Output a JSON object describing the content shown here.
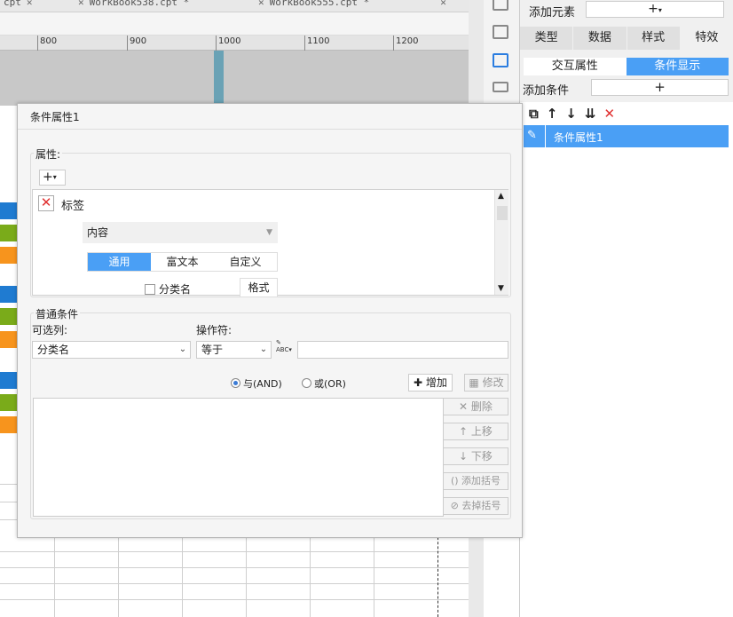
{
  "editor": {
    "file_tabs": [
      {
        "label": "cpt"
      },
      {
        "label": "WorkBook538.cpt *"
      },
      {
        "label": "WorkBook555.cpt *"
      }
    ],
    "ruler_marks": [
      "800",
      "900",
      "1000",
      "1100",
      "1200"
    ]
  },
  "right_panel": {
    "add_element_label": "添加元素",
    "add_element_button": "+",
    "tabs": [
      "类型",
      "数据",
      "样式",
      "特效"
    ],
    "active_tab": "特效",
    "sub_tabs": [
      "交互属性",
      "条件显示"
    ],
    "active_sub_tab": "条件显示",
    "add_condition_label": "添加条件",
    "add_condition_button": "+",
    "condition_items": [
      "条件属性1"
    ]
  },
  "dialog": {
    "title": "条件属性1",
    "attributes": {
      "group_label": "属性:",
      "add_button": "+",
      "attr_name": "标签",
      "content_select": "内容",
      "format_tabs": [
        "通用",
        "富文本",
        "自定义"
      ],
      "active_format_tab": "通用",
      "category_checkbox": "分类名",
      "format_button": "格式"
    },
    "conditions": {
      "group_label": "普通条件",
      "column_label": "可选列:",
      "operator_label": "操作符:",
      "column_value": "分类名",
      "operator_value": "等于",
      "value_input": "",
      "and_label": "与(AND)",
      "or_label": "或(OR)",
      "add_label": "增加",
      "modify_label": "修改",
      "delete_label": "删除",
      "up_label": "上移",
      "down_label": "下移",
      "add_paren_label": "添加括号",
      "remove_paren_label": "去掉括号"
    }
  },
  "colors": {
    "accent": "#4a9ff5",
    "bar_blue": "#1f7bd1",
    "bar_green": "#7aab1a",
    "bar_orange": "#f7941d",
    "delete_red": "#e03030"
  }
}
